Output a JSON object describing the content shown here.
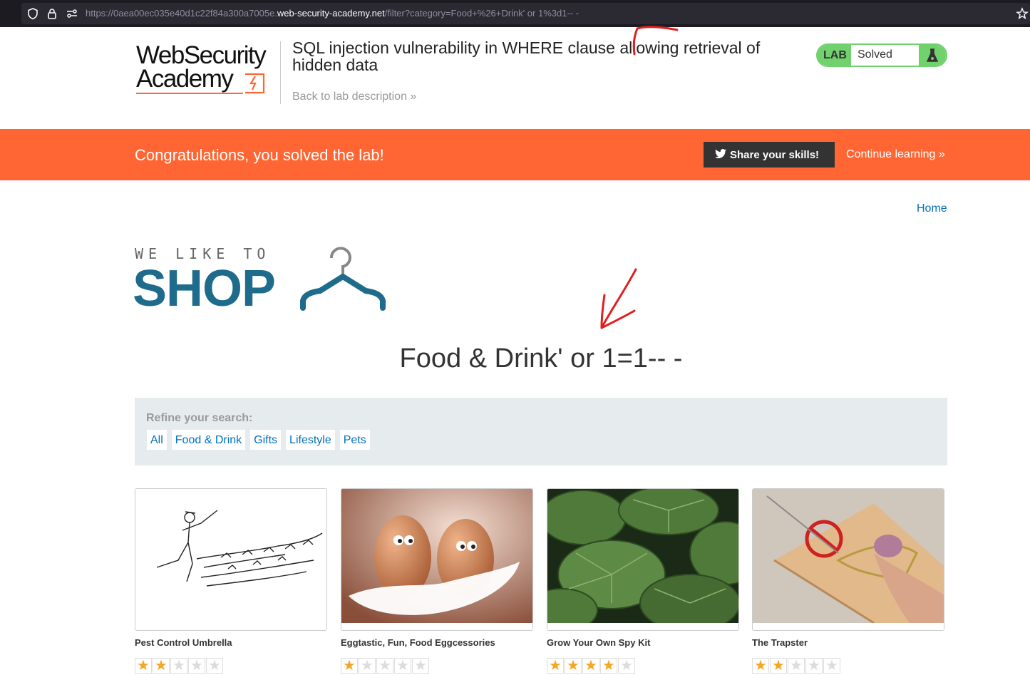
{
  "browser": {
    "url_prefix": "https://0aea00ec035e40d1c22f84a300a7005e.",
    "url_domain": "web-security-academy.net",
    "url_path": "/filter?category=Food+%26+Drink' or 1%3d1-- -"
  },
  "academy": {
    "logo_line1": "WebSecurity",
    "logo_line2": "Academy",
    "lab_title": "SQL injection vulnerability in WHERE clause allowing retrieval of hidden data",
    "back_link": "Back to lab description »",
    "badge_label": "LAB",
    "badge_status": "Solved"
  },
  "banner": {
    "message": "Congratulations, you solved the lab!",
    "share_label": "Share your skills!",
    "continue_label": "Continue learning »"
  },
  "nav": {
    "home_label": "Home"
  },
  "shop": {
    "tagline": "WE LIKE TO",
    "word": "SHOP",
    "heading": "Food & Drink' or 1=1-- -"
  },
  "refine": {
    "label": "Refine your search:",
    "filters": [
      "All",
      "Food & Drink",
      "Gifts",
      "Lifestyle",
      "Pets"
    ]
  },
  "products": [
    {
      "name": "Pest Control Umbrella",
      "rating": 2
    },
    {
      "name": "Eggtastic, Fun, Food Eggcessories",
      "rating": 1
    },
    {
      "name": "Grow Your Own Spy Kit",
      "rating": 4
    },
    {
      "name": "The Trapster",
      "rating": 2
    }
  ],
  "colors": {
    "accent_orange": "#ff6633",
    "lab_green": "#70d16d",
    "link_blue": "#0071bc",
    "shop_blue": "#1f6b8b",
    "star_gold": "#f5a623"
  },
  "icons": [
    "shield-icon",
    "lock-icon",
    "permissions-icon",
    "bookmark-star-icon",
    "lightning-icon",
    "flask-icon",
    "twitter-icon",
    "hanger-icon",
    "star-icon"
  ]
}
